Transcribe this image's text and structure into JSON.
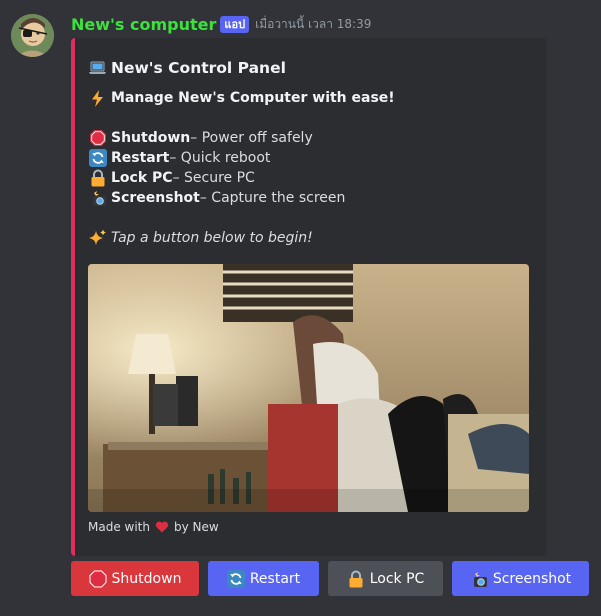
{
  "message": {
    "username": "New's computer",
    "badge": "แอป",
    "timestamp": "เมื่อวานนี้ เวลา 18:39",
    "username_color": "#3ce23c",
    "avatar_icon": "eyepatch-cartoon-avatar"
  },
  "embed": {
    "accent_color": "#dd2e5d",
    "title": "New's Control Panel",
    "title_icon": "laptop-icon",
    "subtitle": "Manage New's Computer with ease!",
    "subtitle_icon": "lightning-icon",
    "actions": [
      {
        "icon": "stop-sign-icon",
        "name": "Shutdown",
        "desc": " – Power off safely"
      },
      {
        "icon": "refresh-icon",
        "name": "Restart",
        "desc": " – Quick reboot"
      },
      {
        "icon": "lock-icon",
        "name": "Lock PC",
        "desc": " – Secure PC"
      },
      {
        "icon": "camera-flash-icon",
        "name": "Screenshot",
        "desc": " – Capture the screen"
      }
    ],
    "prompt": "Tap a button below to begin!",
    "prompt_icon": "sparkles-icon",
    "footer": {
      "made_with": "Made with",
      "by": "by New",
      "heart_icon": "heart-icon"
    }
  },
  "buttons": [
    {
      "label": "Shutdown",
      "icon": "stop-sign-icon",
      "style": "danger",
      "color": "#da373c"
    },
    {
      "label": "Restart",
      "icon": "refresh-icon",
      "style": "primary",
      "color": "#5865f2"
    },
    {
      "label": "Lock PC",
      "icon": "lock-icon",
      "style": "secondary",
      "color": "#4e5058"
    },
    {
      "label": "Screenshot",
      "icon": "camera-flash-icon",
      "style": "primary",
      "color": "#5865f2"
    }
  ]
}
